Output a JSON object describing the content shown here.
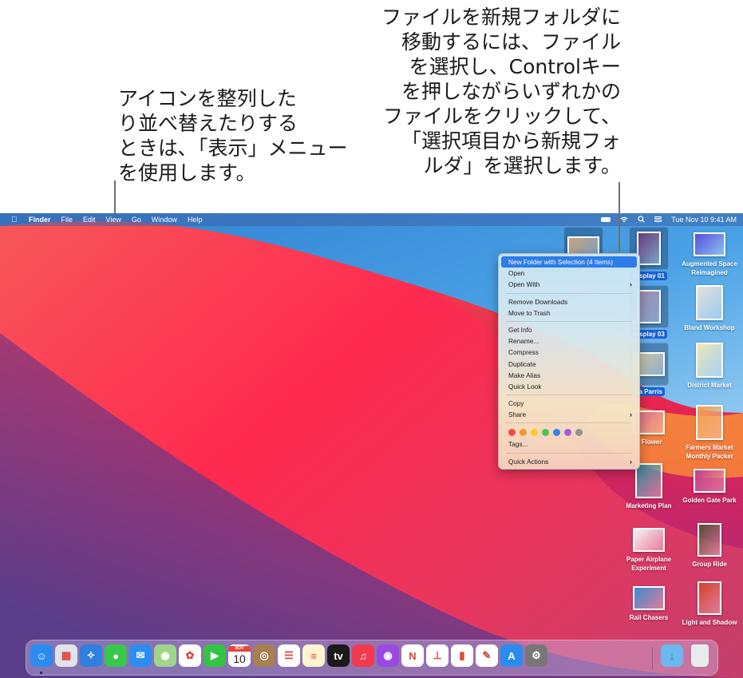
{
  "callouts": {
    "left": "アイコンを整列した\nり並べ替えたりする\nときは､「表示」メニュー\nを使用します。",
    "right": "ファイルを新規フォルダに\n移動するには、ファイル\nを選択し、Controlキー\nを押しながらいずれかの\nファイルをクリックして、\n「選択項目から新規フォ\nルダ」を選択します。"
  },
  "menubar": {
    "apple_icon": "apple-icon",
    "app_name": "Finder",
    "items": [
      "File",
      "Edit",
      "View",
      "Go",
      "Window",
      "Help"
    ],
    "status_icons": [
      "battery-icon",
      "wifi-icon",
      "spotlight-search-icon",
      "control-center-icon"
    ],
    "clock": "Tue Nov 10  9:41 AM"
  },
  "desktop_icons": [
    {
      "label": "",
      "selected": true,
      "thumb_color": "#c9a27a"
    },
    {
      "label": "Display 01",
      "selected": true,
      "thumb_color": "#6a3c7c"
    },
    {
      "label": "Augmented Space Reimagined",
      "selected": false,
      "thumb_color": "#5b4de0"
    },
    {
      "label": "Display 03",
      "selected": true,
      "thumb_color": "#a58ab6"
    },
    {
      "label": "Bland Workshop",
      "selected": false,
      "thumb_color": "#e8e2da"
    },
    {
      "label": "sa Parris",
      "selected": true,
      "thumb_color": "#d8c8a0"
    },
    {
      "label": "District Market",
      "selected": false,
      "thumb_color": "#f1e6b8"
    },
    {
      "label": "o Flower",
      "selected": false,
      "thumb_color": "#d96a8a"
    },
    {
      "label": "Farmers Market Monthly Packet",
      "selected": false,
      "thumb_color": "#f2a24c"
    },
    {
      "label": "Marketing Plan",
      "selected": false,
      "thumb_color": "#2e8a9a"
    },
    {
      "label": "Golden Gate Park",
      "selected": false,
      "thumb_color": "#c23b8a"
    },
    {
      "label": "Paper Airplane Experiment",
      "selected": false,
      "thumb_color": "#f4f4f4"
    },
    {
      "label": "Group Ride",
      "selected": false,
      "thumb_color": "#5c4a34"
    },
    {
      "label": "Rail Chasers",
      "selected": false,
      "thumb_color": "#3a8ad0"
    },
    {
      "label": "Light and Shadow",
      "selected": false,
      "thumb_color": "#d8402c"
    }
  ],
  "context_menu": {
    "items": [
      {
        "label": "New Folder with Selection (4 Items)",
        "highlighted": true
      },
      {
        "label": "Open"
      },
      {
        "label": "Open With",
        "submenu": true
      },
      {
        "label": "Remove Downloads"
      },
      {
        "label": "Move to Trash"
      },
      {
        "label": "Get Info"
      },
      {
        "label": "Rename..."
      },
      {
        "label": "Compress"
      },
      {
        "label": "Duplicate"
      },
      {
        "label": "Make Alias"
      },
      {
        "label": "Quick Look"
      },
      {
        "label": "Copy"
      },
      {
        "label": "Share",
        "submenu": true
      },
      {
        "label": "Tags..."
      },
      {
        "label": "Quick Actions",
        "submenu": true
      }
    ],
    "submenu_chevron": "›",
    "tag_colors": [
      {
        "name": "red",
        "hex": "#f04a44"
      },
      {
        "name": "orange",
        "hex": "#f5962c"
      },
      {
        "name": "yellow",
        "hex": "#f7cc2a"
      },
      {
        "name": "green",
        "hex": "#4ac553"
      },
      {
        "name": "blue",
        "hex": "#3382f0"
      },
      {
        "name": "purple",
        "hex": "#a45ad2"
      },
      {
        "name": "gray",
        "hex": "#929292"
      }
    ],
    "highlight_color": "#2d7ce8"
  },
  "dock": {
    "apps": [
      {
        "name": "Finder",
        "icon": "finder-icon",
        "bg": "#2a8cf0",
        "glyph": "☺",
        "running": true
      },
      {
        "name": "Launchpad",
        "icon": "launchpad-icon",
        "bg": "#dfe3ea",
        "glyph": "▦"
      },
      {
        "name": "Safari",
        "icon": "safari-icon",
        "bg": "#2f7fe0",
        "glyph": "✧"
      },
      {
        "name": "Messages",
        "icon": "messages-icon",
        "bg": "#39c84a",
        "glyph": "●"
      },
      {
        "name": "Mail",
        "icon": "mail-icon",
        "bg": "#2b8df2",
        "glyph": "✉"
      },
      {
        "name": "Maps",
        "icon": "maps-icon",
        "bg": "#9fd58a",
        "glyph": "◉"
      },
      {
        "name": "Photos",
        "icon": "photos-icon",
        "bg": "#ffffff",
        "glyph": "✿"
      },
      {
        "name": "FaceTime",
        "icon": "facetime-icon",
        "bg": "#33c444",
        "glyph": "▶"
      },
      {
        "name": "Calendar",
        "icon": "calendar-icon",
        "bg": "#ffffff",
        "glyph": "10",
        "month": "NOV"
      },
      {
        "name": "Contacts",
        "icon": "contacts-icon",
        "bg": "#a8804e",
        "glyph": "◎"
      },
      {
        "name": "Reminders",
        "icon": "reminders-icon",
        "bg": "#ffffff",
        "glyph": "☰"
      },
      {
        "name": "Notes",
        "icon": "notes-icon",
        "bg": "#fff6d0",
        "glyph": "≡"
      },
      {
        "name": "TV",
        "icon": "apple-tv-icon",
        "bg": "#1a1a1a",
        "glyph": "tv"
      },
      {
        "name": "Music",
        "icon": "music-icon",
        "bg": "#f23a4e",
        "glyph": "♫"
      },
      {
        "name": "Podcasts",
        "icon": "podcasts-icon",
        "bg": "#9a4ae0",
        "glyph": "◉"
      },
      {
        "name": "News",
        "icon": "news-icon",
        "bg": "#ffffff",
        "glyph": "N"
      },
      {
        "name": "Keynote",
        "icon": "keynote-icon",
        "bg": "#ffffff",
        "glyph": "⊥"
      },
      {
        "name": "Numbers",
        "icon": "numbers-icon",
        "bg": "#ffffff",
        "glyph": "▮"
      },
      {
        "name": "Pages",
        "icon": "pages-icon",
        "bg": "#ffffff",
        "glyph": "✎"
      },
      {
        "name": "App Store",
        "icon": "app-store-icon",
        "bg": "#2a8cf0",
        "glyph": "A"
      },
      {
        "name": "System Preferences",
        "icon": "system-preferences-icon",
        "bg": "#777777",
        "glyph": "⚙"
      }
    ],
    "stack": {
      "name": "Downloads",
      "icon": "downloads-folder-icon",
      "bg": "#6ab8ee",
      "glyph": "↓"
    },
    "trash": {
      "name": "Trash",
      "icon": "trash-icon",
      "bg": "#e8ecef",
      "glyph": ""
    }
  }
}
